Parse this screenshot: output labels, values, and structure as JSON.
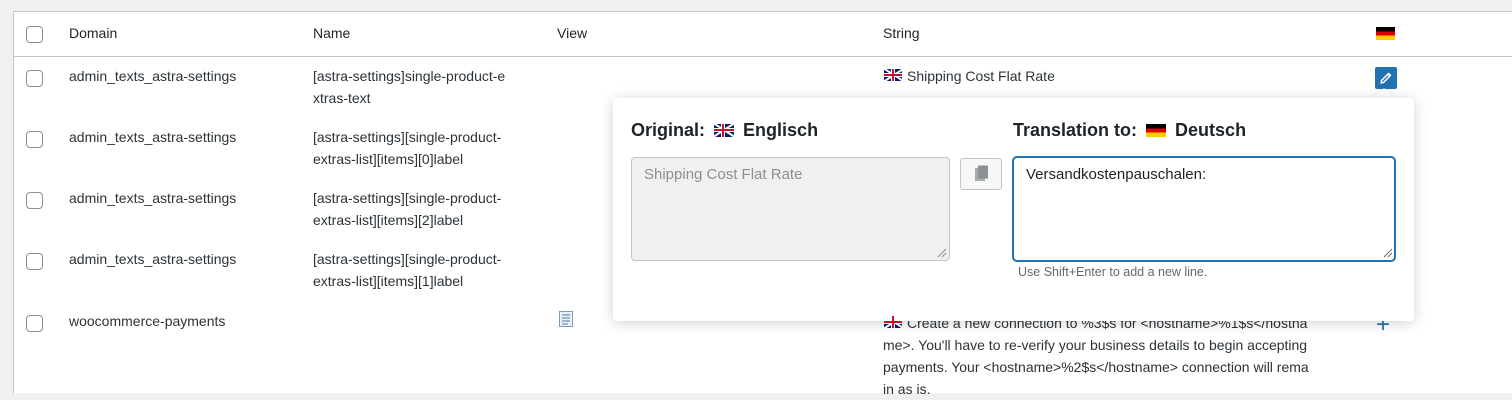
{
  "columns": {
    "domain": "Domain",
    "name": "Name",
    "view": "View",
    "string": "String",
    "language_flag": "flag-de-icon"
  },
  "rows": [
    {
      "domain": "admin_texts_astra-settings",
      "name_line1": "[astra-settings]single-product-e",
      "name_line2": "xtras-text",
      "string": "Shipping Cost Flat Rate",
      "action": "edit"
    },
    {
      "domain": "admin_texts_astra-settings",
      "name_line1": "[astra-settings][single-product-",
      "name_line2": "extras-list][items][0]label"
    },
    {
      "domain": "admin_texts_astra-settings",
      "name_line1": "[astra-settings][single-product-",
      "name_line2": "extras-list][items][2]label"
    },
    {
      "domain": "admin_texts_astra-settings",
      "name_line1": "[astra-settings][single-product-",
      "name_line2": "extras-list][items][1]label"
    },
    {
      "domain": "woocommerce-payments",
      "name_line1": "",
      "name_line2": "",
      "string_lines": [
        "Create a new connection to %3$s for <hostname>%1$s</hostna",
        "me>. You'll have to re-verify your business details to begin accepting",
        "payments. Your <hostname>%2$s</hostname> connection will rema",
        "in as is."
      ],
      "action": "add"
    }
  ],
  "popup": {
    "original_label": "Original:",
    "original_language": "Englisch",
    "translation_label": "Translation to:",
    "translation_language": "Deutsch",
    "original_text": "Shipping Cost Flat Rate",
    "translation_value": "Versandkostenpauschalen:",
    "hint": "Use Shift+Enter to add a new line."
  },
  "colors": {
    "accent": "#2271b1",
    "border": "#c3c4c7",
    "background": "#f0f0f1"
  }
}
